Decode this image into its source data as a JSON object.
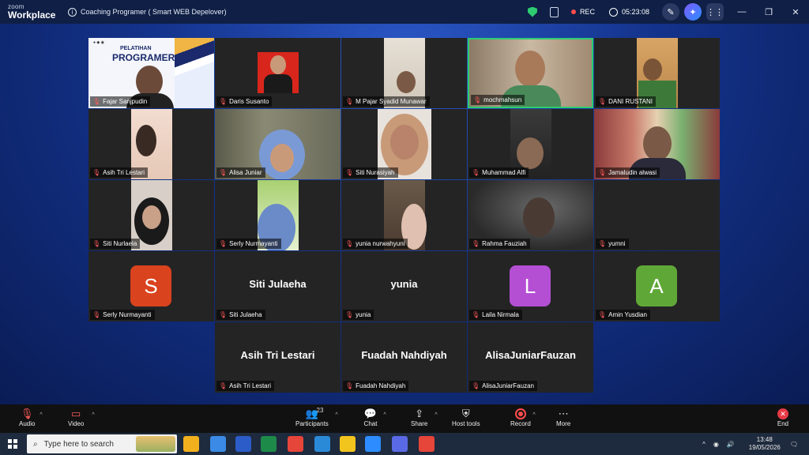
{
  "app": {
    "brand_small": "zoom",
    "brand": "Workplace",
    "meeting_title": "Coaching Programer ( Smart WEB Depelover)"
  },
  "titlebar": {
    "rec_label": "REC",
    "timer": "05:23:08"
  },
  "banner": {
    "line1": "PELATIHAN",
    "line2": "PROGRAMER"
  },
  "participants": [
    {
      "name": "Fajar Sanjpudin"
    },
    {
      "name": "Daris Susanto"
    },
    {
      "name": "M Pajar Syadid Munawar"
    },
    {
      "name": "mochmahsun"
    },
    {
      "name": "DANI RUSTANI"
    },
    {
      "name": "Asih Tri Lestari"
    },
    {
      "name": "Alisa Juniar"
    },
    {
      "name": "Siti Nurasiyah"
    },
    {
      "name": "Muhammad Alfi"
    },
    {
      "name": "Jamaludin alwasi"
    },
    {
      "name": "Siti Nurlaela"
    },
    {
      "name": "Serly Nurmayanti"
    },
    {
      "name": "yunia nurwahyuni"
    },
    {
      "name": "Rahma Fauziah"
    },
    {
      "name": "yumni"
    },
    {
      "name": "Serly Nurmayanti",
      "avatar": "S",
      "color": "#d9431e"
    },
    {
      "name": "Siti Julaeha",
      "display": "Siti Julaeha"
    },
    {
      "name": "yunia",
      "display": "yunia"
    },
    {
      "name": "Laila Nirmala",
      "avatar": "L",
      "color": "#b44fd4"
    },
    {
      "name": "Amin Yusdian",
      "avatar": "A",
      "color": "#5fa838"
    },
    {
      "name": "Asih Tri Lestari",
      "display": "Asih Tri Lestari"
    },
    {
      "name": "Fuadah Nahdiyah",
      "display": "Fuadah Nahdiyah"
    },
    {
      "name": "AlisaJuniarFauzan",
      "display": "AlisaJuniarFauzan"
    }
  ],
  "toolbar": {
    "audio": "Audio",
    "video": "Video",
    "participants": "Participants",
    "participant_count": "23",
    "chat": "Chat",
    "share": "Share",
    "host_tools": "Host tools",
    "record": "Record",
    "more": "More",
    "end": "End"
  },
  "taskbar": {
    "search_placeholder": "Type here to search",
    "time": "13:48",
    "date": "19/05/2026"
  }
}
